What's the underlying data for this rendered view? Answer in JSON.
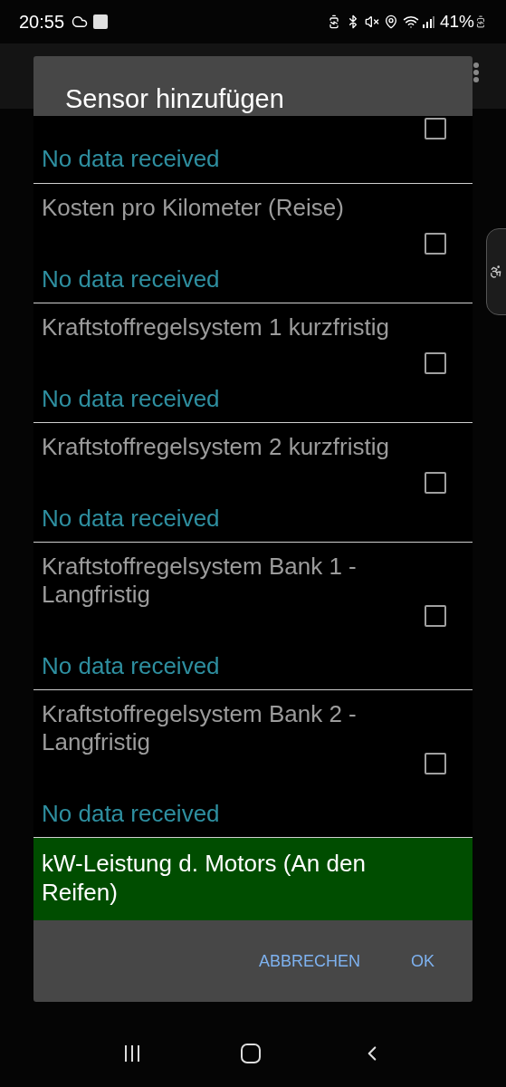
{
  "status_bar": {
    "time": "20:55",
    "battery": "41%"
  },
  "dialog": {
    "title": "Sensor hinzufügen",
    "items": [
      {
        "status": "No data received",
        "checked": false,
        "selected": false,
        "kind": "partial"
      },
      {
        "name": "Kosten pro Kilometer (Reise)",
        "status": "No data received",
        "checked": false,
        "selected": false,
        "kind": "full"
      },
      {
        "name": "Kraftstoffregelsystem 1 kurzfristig",
        "status": "No data received",
        "checked": false,
        "selected": false,
        "kind": "full"
      },
      {
        "name": "Kraftstoffregelsystem 2 kurzfristig",
        "status": "No data received",
        "checked": false,
        "selected": false,
        "kind": "full"
      },
      {
        "name": "Kraftstoffregelsystem Bank 1 - Langfristig",
        "status": "No data received",
        "checked": false,
        "selected": false,
        "kind": "full"
      },
      {
        "name": "Kraftstoffregelsystem Bank 2 - Langfristig",
        "status": "No data received",
        "checked": false,
        "selected": false,
        "kind": "full"
      },
      {
        "name": "kW-Leistung d. Motors (An den Reifen)",
        "selected": true,
        "kind": "cut"
      }
    ],
    "buttons": [
      "ABBRECHEN",
      "OK"
    ]
  }
}
